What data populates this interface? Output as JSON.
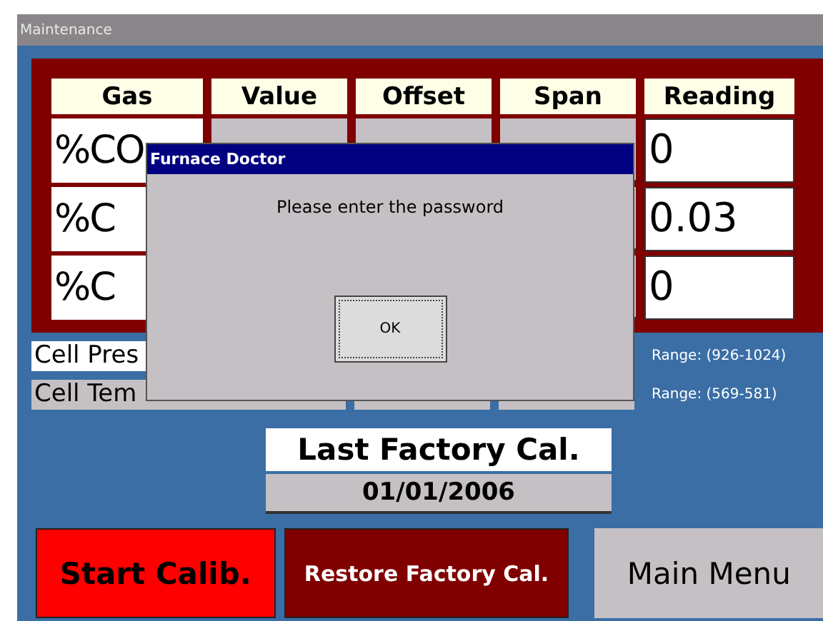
{
  "window": {
    "title": "Maintenance"
  },
  "table": {
    "columns": [
      "Gas",
      "Value",
      "Offset",
      "Span",
      "Reading"
    ],
    "rows": [
      {
        "gas": "%CO",
        "reading": "0"
      },
      {
        "gas": "%C",
        "reading": "0.03"
      },
      {
        "gas": "%C",
        "reading": "0"
      }
    ]
  },
  "cell_rows": [
    {
      "label": "Cell Pres",
      "range": "Range:  (926-1024)"
    },
    {
      "label": "Cell Tem",
      "range": "Range:  (569-581)"
    }
  ],
  "last_cal": {
    "heading": "Last Factory Cal.",
    "date": "01/01/2006"
  },
  "buttons": [
    {
      "label": "Start Calib.",
      "kind": "start"
    },
    {
      "label": "Restore Factory Cal.",
      "kind": "restore"
    },
    {
      "label": "Main Menu",
      "kind": "menu"
    }
  ],
  "dialog": {
    "title": "Furnace Doctor",
    "message": "Please enter the password",
    "button": "OK"
  }
}
